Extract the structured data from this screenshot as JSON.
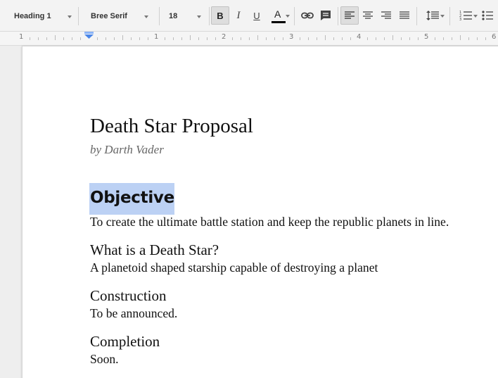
{
  "toolbar": {
    "style_value": "Heading 1",
    "font_value": "Bree Serif",
    "size_value": "18",
    "bold_label": "B",
    "italic_label": "I",
    "underline_label": "U",
    "text_color_label": "A",
    "text_color_hex": "#000000",
    "icons": [
      "link-icon",
      "comment-icon",
      "align-left-icon",
      "align-center-icon",
      "align-right-icon",
      "align-justify-icon",
      "line-spacing-icon",
      "numbered-list-icon",
      "bulleted-list-icon"
    ]
  },
  "ruler": {
    "labels": [
      "1",
      "1",
      "2",
      "3",
      "4",
      "5",
      "6"
    ]
  },
  "document": {
    "title": "Death Star Proposal",
    "subtitle": "by Darth Vader",
    "sections": [
      {
        "heading": "Objective",
        "body": "To create the ultimate battle station and keep the republic planets in line."
      },
      {
        "heading": "What is a Death Star?",
        "body": "A planetoid shaped starship capable of destroying a planet"
      },
      {
        "heading": "Construction",
        "body": "To be announced."
      },
      {
        "heading": "Completion",
        "body": "Soon."
      }
    ]
  },
  "colors": {
    "selection": "#bcd1f4",
    "toolbar_bg": "#f3f3f3",
    "active_button": "#dedede"
  }
}
